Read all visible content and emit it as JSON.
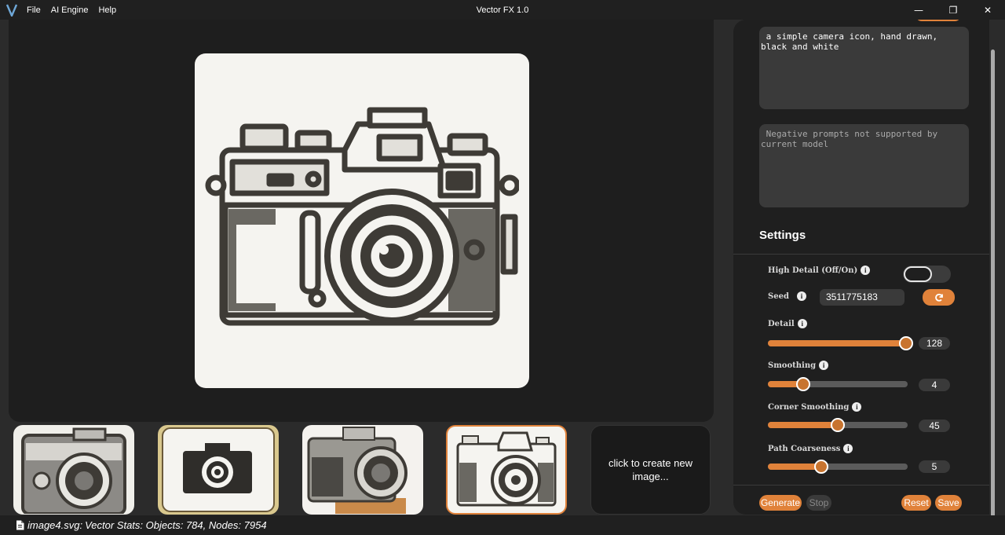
{
  "window": {
    "title": "Vector FX 1.0",
    "menu": [
      "File",
      "AI Engine",
      "Help"
    ],
    "controls": {
      "minimize": "—",
      "restore": "❐",
      "close": "✕"
    }
  },
  "canvas": {
    "new_image_text": "click to create new image..."
  },
  "prompts": {
    "positive": " a simple camera icon, hand drawn,\nblack and white",
    "negative": " Negative prompts not supported by\ncurrent model"
  },
  "settings": {
    "title": "Settings",
    "high_detail_label": "High Detail (Off/On)",
    "high_detail_on": false,
    "seed_label": "Seed",
    "seed_value": "3511775183",
    "detail_label": "Detail",
    "detail_value": "128",
    "detail_fraction": 0.99,
    "smoothing_label": "Smoothing",
    "smoothing_value": "4",
    "smoothing_fraction": 0.25,
    "corner_label": "Corner Smoothing",
    "corner_value": "45",
    "corner_fraction": 0.5,
    "coarseness_label": "Path Coarseness",
    "coarseness_value": "5",
    "coarseness_fraction": 0.38
  },
  "actions": {
    "generate": "Generate",
    "stop": "Stop",
    "reset": "Reset",
    "save": "Save"
  },
  "status": {
    "filename": "image4.svg:",
    "stats": "Vector Stats: Objects: 784, Nodes: 7954"
  },
  "colors": {
    "accent": "#e0823a",
    "panel": "#1f1f1f",
    "background": "#2b2b2b"
  }
}
